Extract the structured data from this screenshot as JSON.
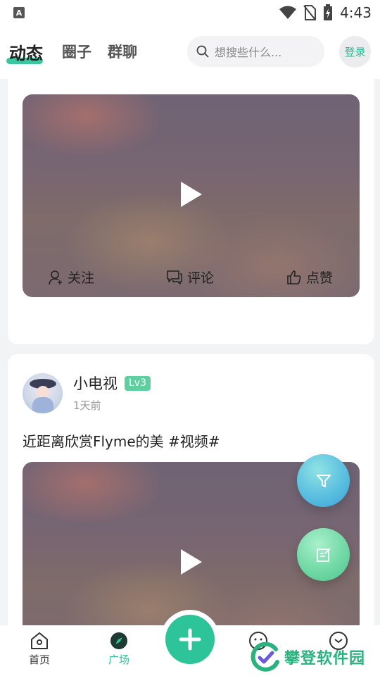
{
  "status_bar": {
    "time": "4:43",
    "app_icon_letter": "A"
  },
  "header": {
    "tabs": [
      {
        "label": "动态",
        "active": true
      },
      {
        "label": "圈子"
      },
      {
        "label": "群聊"
      }
    ],
    "search": {
      "placeholder": "想搜些什么..."
    },
    "login_label": "登录"
  },
  "actions": {
    "follow": "关注",
    "comment": "评论",
    "like": "点赞"
  },
  "post": {
    "username": "小电视",
    "level": "Lv3",
    "time": "1天前",
    "text": "近距离欣赏Flyme的美 #视频#"
  },
  "bottom_nav": {
    "items": [
      {
        "label": "首页",
        "icon": "home-icon"
      },
      {
        "label": "广场",
        "icon": "compass-icon",
        "active": true
      }
    ]
  },
  "watermark": {
    "text": "攀登软件园"
  },
  "colors": {
    "accent": "#2ec49a",
    "level_badge": "#5ecf9e"
  }
}
